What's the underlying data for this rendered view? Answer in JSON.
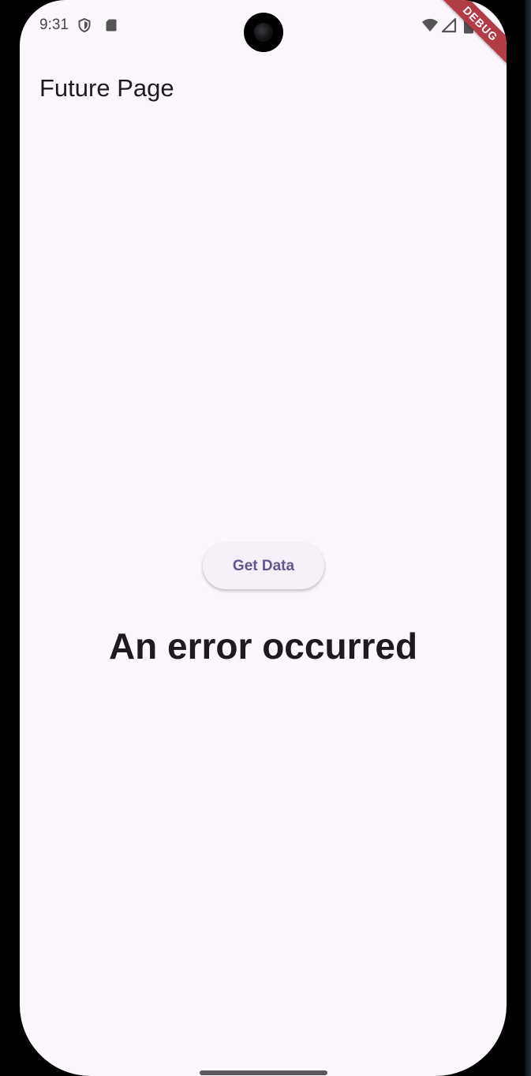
{
  "status_bar": {
    "time": "9:31",
    "icons": [
      "shield-icon",
      "sd-card-icon",
      "wifi-icon",
      "signal-icon",
      "battery-icon"
    ]
  },
  "debug_banner": "DEBUG",
  "app_bar": {
    "title": "Future Page"
  },
  "main": {
    "button_label": "Get Data",
    "message": "An error occurred"
  },
  "colors": {
    "background": "#fcf6fd",
    "button_bg": "#f5eff7",
    "button_text": "#65558f",
    "text": "#1d1b20",
    "debug_banner": "#b23b45"
  }
}
